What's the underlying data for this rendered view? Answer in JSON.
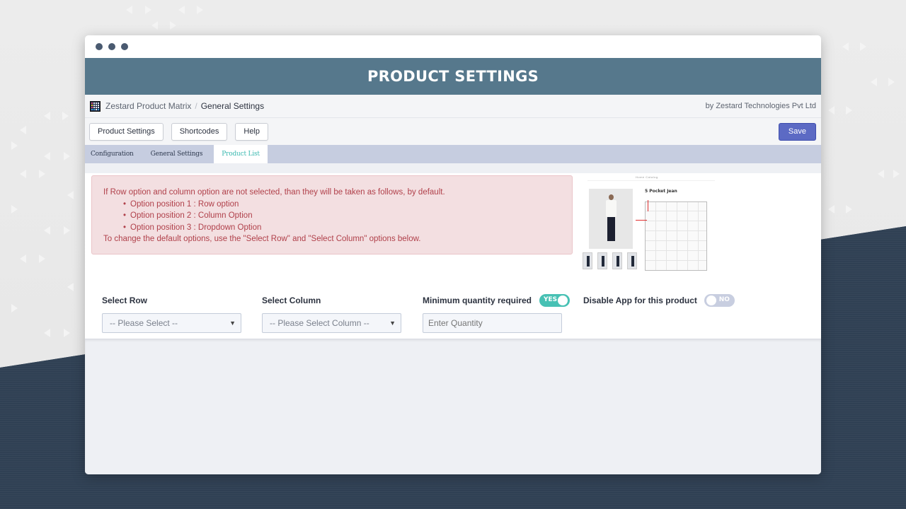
{
  "window": {
    "title": "PRODUCT SETTINGS"
  },
  "breadcrumb": {
    "app_name": "Zestard Product Matrix",
    "separator": "/",
    "current": "General Settings",
    "byline": "by Zestard Technologies Pvt Ltd",
    "logo_icon": "grid-matrix-icon"
  },
  "toolbar": {
    "buttons": [
      {
        "label": "Product Settings"
      },
      {
        "label": "Shortcodes"
      },
      {
        "label": "Help"
      }
    ],
    "save_label": "Save",
    "save_color": "#5c6ac4"
  },
  "tabs": [
    {
      "label": "Configuration",
      "active": false
    },
    {
      "label": "General Settings",
      "active": false
    },
    {
      "label": "Product List",
      "active": true
    }
  ],
  "alert": {
    "intro": "If Row option and column option are not selected, than they will be taken as follows, by default.",
    "items": [
      "Option position 1 : Row option",
      "Option position 2 : Column Option",
      "Option position 3 : Dropdown Option"
    ],
    "outro": "To change the default options, use the \"Select Row\" and \"Select Column\" options below."
  },
  "preview": {
    "product_title": "5 Pocket Jean",
    "nav": "Home  Catalog"
  },
  "form": {
    "select_row": {
      "label": "Select Row",
      "value": "-- Please Select --"
    },
    "select_column": {
      "label": "Select Column",
      "value": "-- Please Select Column --"
    },
    "min_quantity": {
      "label": "Minimum quantity required",
      "toggle_label": "YES",
      "toggle_on": true,
      "placeholder": "Enter Quantity",
      "value": ""
    },
    "disable_app": {
      "label": "Disable App for this product",
      "toggle_label": "NO",
      "toggle_on": false
    }
  },
  "colors": {
    "hero": "#56788c",
    "accent_teal": "#47c1b4",
    "alert_text": "#b0404a",
    "tabs_bg": "#c6cde0"
  }
}
